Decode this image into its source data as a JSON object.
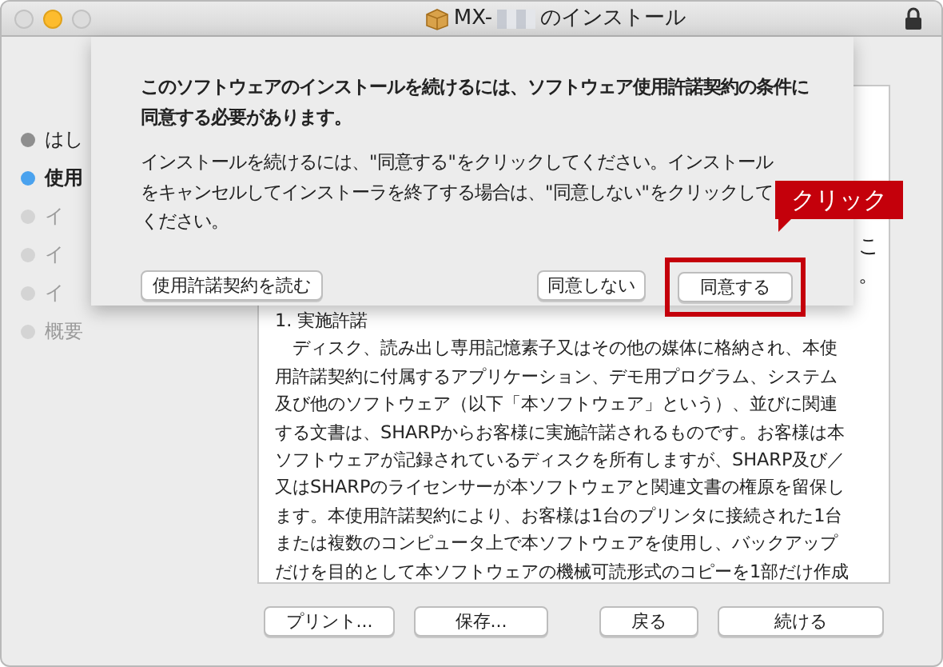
{
  "window": {
    "title_prefix": "MX-",
    "title_suffix": "のインストール"
  },
  "sidebar": {
    "items": [
      {
        "label": "はし",
        "selected": false,
        "disabled": false
      },
      {
        "label": "使用",
        "selected": true,
        "disabled": false
      },
      {
        "label": "イ",
        "selected": false,
        "disabled": true
      },
      {
        "label": "イ",
        "selected": false,
        "disabled": true
      },
      {
        "label": "イ",
        "selected": false,
        "disabled": true
      },
      {
        "label": "概要",
        "selected": false,
        "disabled": true
      }
    ]
  },
  "license": {
    "fragments": [
      "こ",
      "。"
    ],
    "heading": "1. 実施許諾",
    "lines": [
      "　ディスク、読み出し専用記憶素子又はその他の媒体に格納され、本使",
      "用許諾契約に付属するアプリケーション、デモ用プログラム、システム",
      "及び他のソフトウェア（以下「本ソフトウェア」という）、並びに関連",
      "する文書は、SHARPからお客様に実施許諾されるものです。お客様は本",
      "ソフトウェアが記録されているディスクを所有しますが、SHARP及び／",
      "又はSHARPのライセンサーが本ソフトウェアと関連文書の権原を留保し",
      "ます。本使用許諾契約により、お客様は1台のプリンタに接続された1台",
      "または複数のコンピュータ上で本ソフトウェアを使用し、バックアップ",
      "だけを目的として本ソフトウェアの機械可読形式のコピーを1部だけ作成"
    ]
  },
  "buttons": [
    "プリント...",
    "保存...",
    "戻る",
    "続ける"
  ],
  "sheet": {
    "message": "このソフトウェアのインストールを続けるには、ソフトウェア使用許諾契約の条件に同意する必要があります。",
    "info": "インストールを続けるには、\"同意する\"をクリックしてください。インストールをキャンセルしてインストーラを終了する場合は、\"同意しない\"をクリックしてください。",
    "read_button": "使用許諾契約を読む",
    "disagree_button": "同意しない",
    "agree_button": "同意する"
  },
  "callout": {
    "label": "クリック"
  }
}
